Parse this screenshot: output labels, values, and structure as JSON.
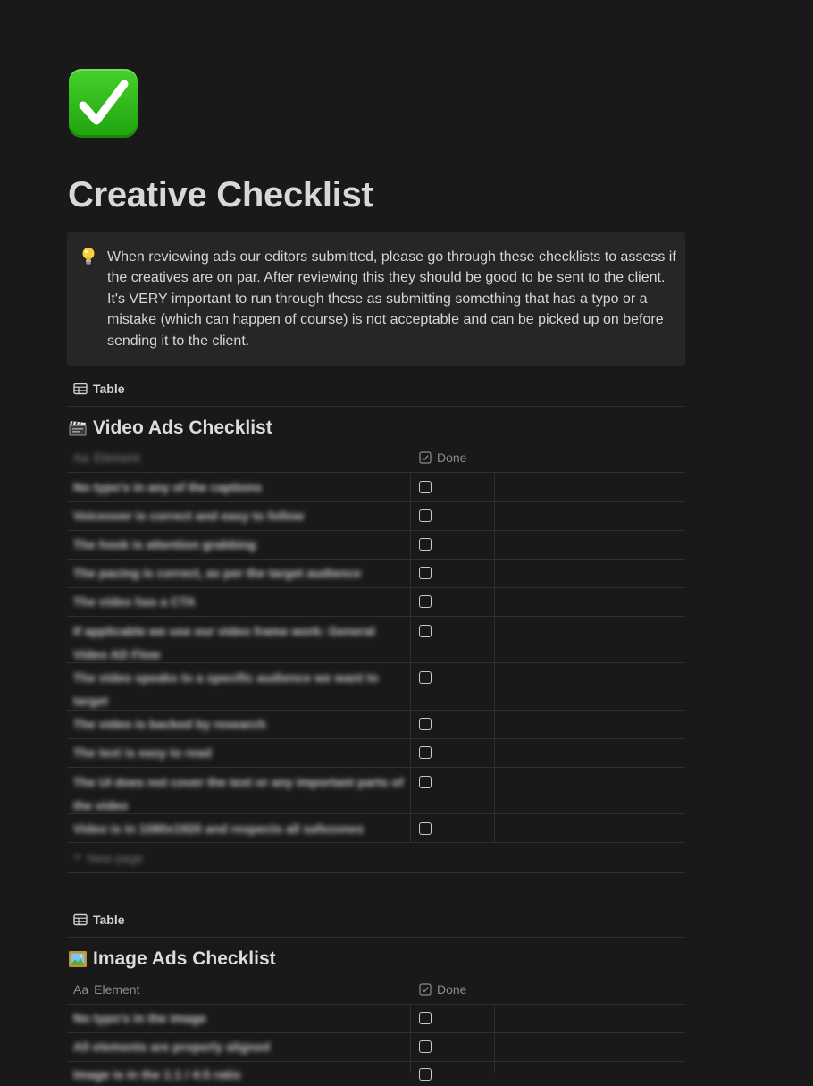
{
  "page": {
    "icon": "check-mark-button-icon",
    "title": "Creative Checklist"
  },
  "callout": {
    "icon": "light-bulb-icon",
    "text": "When reviewing ads our editors submitted, please go through these checklists to assess if the creatives are on par. After reviewing this they should be good to be sent to the client. It's VERY important to run through these as submitting something that has a typo or a mistake (which can happen of course) is not acceptable and can be picked up on before sending it to the client."
  },
  "databases": [
    {
      "view_label": "Table",
      "title": "Video Ads Checklist",
      "title_icon": "clapper-board-icon",
      "columns": {
        "element": "Element",
        "element_icon_text": "Aa",
        "done": "Done"
      },
      "rows": [
        {
          "element": "No typo's in any of the captions",
          "done": false
        },
        {
          "element": "Voiceover is correct and easy to follow",
          "done": false
        },
        {
          "element": "The hook is attention grabbing",
          "done": false
        },
        {
          "element": "The pacing is correct, as per the target audience",
          "done": false
        },
        {
          "element": "The video has a CTA",
          "done": false
        },
        {
          "element": "If applicable we use our video frame work: General Video AD Flow",
          "done": false
        },
        {
          "element": "The video speaks to a specific audience we want to target",
          "done": false
        },
        {
          "element": "The video is backed by research",
          "done": false
        },
        {
          "element": "The text is easy to read",
          "done": false
        },
        {
          "element": "The UI does not cover the text or any important parts of the video",
          "done": false
        },
        {
          "element": "Video is in 1080x1920 and respects all safezones",
          "done": false
        }
      ],
      "new_page_label": "New page"
    },
    {
      "view_label": "Table",
      "title": "Image Ads Checklist",
      "title_icon": "framed-picture-icon",
      "columns": {
        "element": "Element",
        "element_icon_text": "Aa",
        "done": "Done"
      },
      "rows": [
        {
          "element": "No typo's in the image",
          "done": false
        },
        {
          "element": "All elements are properly aligned",
          "done": false
        },
        {
          "element": "Image is in the 1:1 / 4:5 ratio",
          "done": false
        }
      ]
    }
  ],
  "colors": {
    "background": "#191919",
    "callout_bg": "#262626",
    "divider": "#2f2f2f",
    "text": "#d4d4d4",
    "muted": "#8c8c8c",
    "icon_green": "#2db31b"
  }
}
